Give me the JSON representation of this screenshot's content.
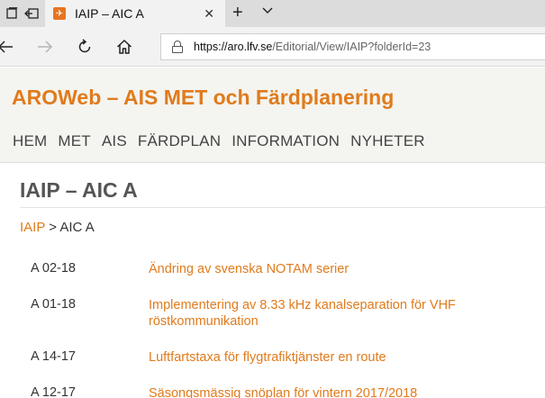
{
  "browser": {
    "tab": {
      "title": "IAIP – AIC A",
      "favicon": "plane-icon"
    },
    "address": {
      "url_host": "https://aro.lfv.se",
      "url_path": "/Editorial/View/IAIP?folderId=23"
    }
  },
  "site": {
    "title": "AROWeb – AIS MET och Färdplanering",
    "nav": [
      "HEM",
      "MET",
      "AIS",
      "FÄRDPLAN",
      "INFORMATION",
      "NYHETER"
    ]
  },
  "page": {
    "title": "IAIP – AIC A",
    "breadcrumb": {
      "link": "IAIP",
      "separator": ">",
      "current": "AIC A"
    }
  },
  "documents": [
    {
      "code": "A 02-18",
      "title": "Ändring av svenska NOTAM serier"
    },
    {
      "code": "A 01-18",
      "title": "Implementering av 8.33 kHz kanalseparation för VHF röstkommunikation"
    },
    {
      "code": "A 14-17",
      "title": "Luftfartstaxa för flygtrafiktjänster en route"
    },
    {
      "code": "A 12-17",
      "title": "Säsongsmässig snöplan för vintern 2017/2018"
    }
  ],
  "colors": {
    "accent": "#e07b1c",
    "header_bg": "#f4f4f0"
  }
}
